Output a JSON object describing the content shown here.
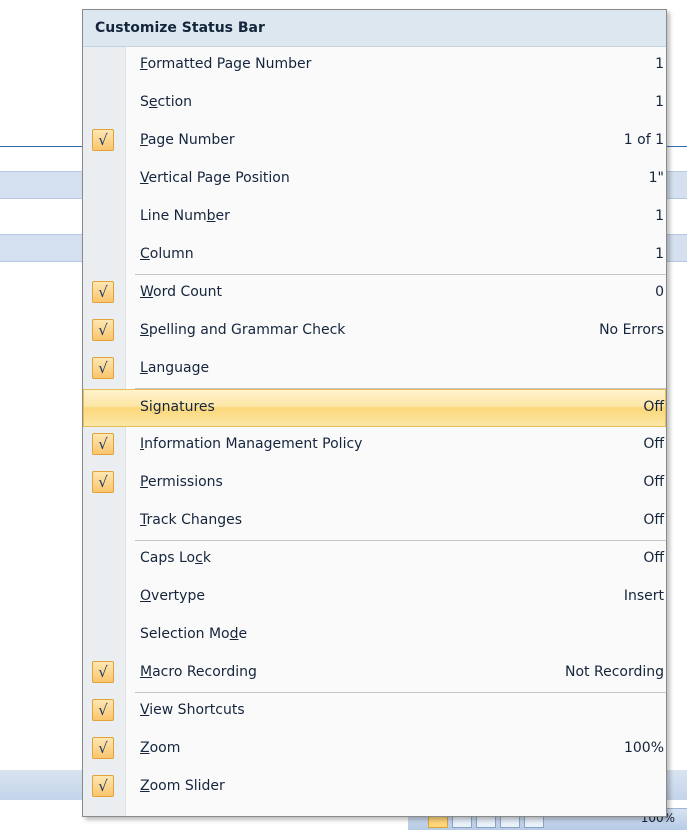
{
  "menu": {
    "title": "Customize Status Bar",
    "items": [
      {
        "label": "Formatted Page Number",
        "access_key_index": 0,
        "value": "1",
        "checked": false
      },
      {
        "label": "Section",
        "access_key_index": 1,
        "value": "1",
        "checked": false
      },
      {
        "label": "Page Number",
        "access_key_index": 0,
        "value": "1 of 1",
        "checked": true
      },
      {
        "label": "Vertical Page Position",
        "access_key_index": 0,
        "value": "1\"",
        "checked": false
      },
      {
        "label": "Line Number",
        "access_key_index": 8,
        "value": "1",
        "checked": false
      },
      {
        "label": "Column",
        "access_key_index": 0,
        "value": "1",
        "checked": false
      },
      {
        "label": "Word Count",
        "access_key_index": 0,
        "value": "0",
        "checked": true
      },
      {
        "label": "Spelling and Grammar Check",
        "access_key_index": 0,
        "value": "No Errors",
        "checked": true
      },
      {
        "label": "Language",
        "access_key_index": 0,
        "value": "",
        "checked": true
      },
      {
        "label": "Signatures",
        "access_key_index": 2,
        "value": "Off",
        "checked": false
      },
      {
        "label": "Information Management Policy",
        "access_key_index": 0,
        "value": "Off",
        "checked": true
      },
      {
        "label": "Permissions",
        "access_key_index": 0,
        "value": "Off",
        "checked": true
      },
      {
        "label": "Track Changes",
        "access_key_index": 0,
        "value": "Off",
        "checked": false
      },
      {
        "label": "Caps Lock",
        "access_key_index": 7,
        "value": "Off",
        "checked": false
      },
      {
        "label": "Overtype",
        "access_key_index": 0,
        "value": "Insert",
        "checked": false
      },
      {
        "label": "Selection Mode",
        "access_key_index": 12,
        "value": "",
        "checked": false
      },
      {
        "label": "Macro Recording",
        "access_key_index": 0,
        "value": "Not Recording",
        "checked": true
      },
      {
        "label": "View Shortcuts",
        "access_key_index": 0,
        "value": "",
        "checked": true
      },
      {
        "label": "Zoom",
        "access_key_index": 0,
        "value": "100%",
        "checked": true
      },
      {
        "label": "Zoom Slider",
        "access_key_index": 0,
        "value": "",
        "checked": true
      }
    ]
  },
  "statusbar": {
    "zoom_label": "100%"
  },
  "icons": {
    "check": "checkmark-icon"
  },
  "colors": {
    "highlight": "#fbd77a",
    "check_bg": "#fbc56d",
    "header_bg": "#dde7ef"
  }
}
